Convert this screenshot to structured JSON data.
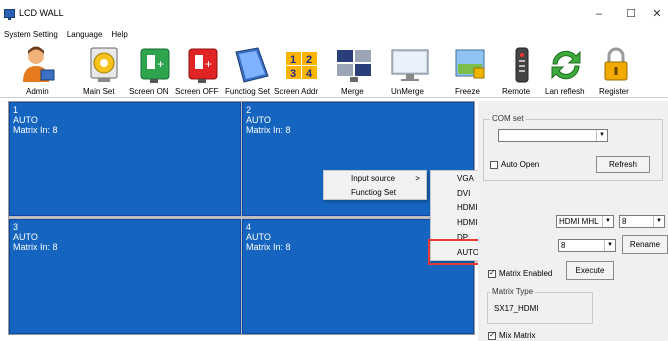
{
  "window": {
    "title": "LCD WALL",
    "minimize": "–",
    "maximize": "☐",
    "close": "✕"
  },
  "menu": [
    "System Setting",
    "Language",
    "Help"
  ],
  "toolbar": [
    {
      "label": "Admin",
      "icon": "admin-person-icon"
    },
    {
      "label": "Main Set",
      "icon": "gear-monitor-icon"
    },
    {
      "label": "Screen ON",
      "icon": "screen-on-plug-icon"
    },
    {
      "label": "Screen OFF",
      "icon": "screen-off-plug-icon"
    },
    {
      "label": "Functiog Set",
      "icon": "wall-panel-icon"
    },
    {
      "label": "Screen Addr",
      "icon": "grid-numbers-icon",
      "digits": [
        "1",
        "2",
        "3",
        "4"
      ]
    },
    {
      "label": "Merge",
      "icon": "merge-monitors-icon"
    },
    {
      "label": "UnMerge",
      "icon": "unmerge-monitor-icon"
    },
    {
      "label": "Freeze",
      "icon": "freeze-monitor-icon"
    },
    {
      "label": "Remote",
      "icon": "remote-control-icon"
    },
    {
      "label": "Lan reflesh",
      "icon": "refresh-arrows-icon"
    },
    {
      "label": "Register",
      "icon": "padlock-icon"
    }
  ],
  "screens": [
    {
      "num": "1",
      "mode": "AUTO",
      "matrix": "Matrix In: 8"
    },
    {
      "num": "2",
      "mode": "AUTO",
      "matrix": "Matrix In: 8"
    },
    {
      "num": "3",
      "mode": "AUTO",
      "matrix": "Matrix In: 8"
    },
    {
      "num": "4",
      "mode": "AUTO",
      "matrix": "Matrix In: 8"
    }
  ],
  "context_menu": {
    "items": [
      "Input source",
      "Functiog Set"
    ],
    "arrow": ">",
    "submenu": [
      "VGA",
      "DVI",
      "HDMI MHL",
      "HDMI 4K",
      "DP",
      "AUTO"
    ]
  },
  "right_panel": {
    "com_set_title": "COM set",
    "com_value": "",
    "auto_open": "Auto Open",
    "refresh": "Refresh",
    "input_type": "HDMI MHL",
    "input_num": "8",
    "matrix_num": "8",
    "rename": "Rename",
    "execute": "Execute",
    "matrix_enabled": "Matrix Enabled",
    "matrix_type_title": "Matrix Type",
    "matrix_type_value": "SX17_HDMI",
    "mix_matrix": "Mix Matrix",
    "check_mark": "✓",
    "dropdown_glyph": "▼"
  },
  "colors": {
    "screen_blue": "#1565c0",
    "highlight_red": "#e53935"
  }
}
